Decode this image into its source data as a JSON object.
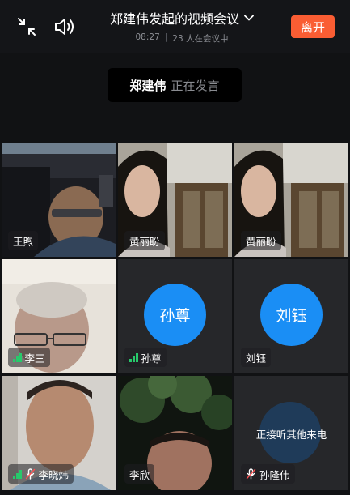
{
  "header": {
    "title": "郑建伟发起的视频会议",
    "time": "08:27",
    "separator": "|",
    "participants": "23 人在会议中",
    "leave_label": "离开",
    "leave_color": "#fa5d33"
  },
  "speaker": {
    "name": "郑建伟",
    "status": "正在发言"
  },
  "tiles": [
    {
      "name": "王煦",
      "kind": "video"
    },
    {
      "name": "黄丽盼",
      "kind": "video"
    },
    {
      "name": "黄丽盼",
      "kind": "video"
    },
    {
      "name": "李三",
      "kind": "video",
      "signal": true
    },
    {
      "name": "孙尊",
      "kind": "avatar",
      "signal": true,
      "avatar_text": "孙尊"
    },
    {
      "name": "刘钰",
      "kind": "avatar",
      "avatar_text": "刘钰"
    },
    {
      "name": "李晓炜",
      "kind": "video",
      "signal": true,
      "muted": true
    },
    {
      "name": "李欣",
      "kind": "video"
    },
    {
      "name": "孙隆伟",
      "kind": "calling",
      "muted": true,
      "status": "正接听其他来电"
    }
  ],
  "icons": [
    "minimize-icon",
    "speaker-icon",
    "chevron-down-icon",
    "signal-icon",
    "mic-off-icon"
  ],
  "colors": {
    "accent": "#1a8ef5",
    "signal": "#27c96b",
    "background": "#111214"
  }
}
